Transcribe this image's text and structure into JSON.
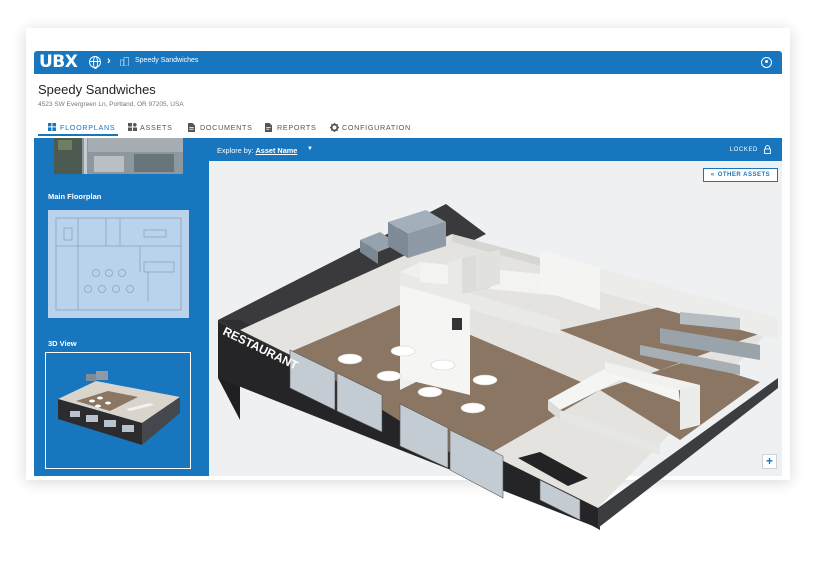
{
  "app": {
    "logo": "UBX"
  },
  "breadcrumb": {
    "location": "Speedy Sandwiches"
  },
  "site": {
    "title": "Speedy Sandwiches",
    "address": "4523 SW Evergreen Ln, Portland, OR 97205, USA"
  },
  "tabs": [
    {
      "label": "FLOORPLANS",
      "icon": "grid-icon",
      "active": true
    },
    {
      "label": "ASSETS",
      "icon": "assets-icon",
      "active": false
    },
    {
      "label": "DOCUMENTS",
      "icon": "document-icon",
      "active": false
    },
    {
      "label": "REPORTS",
      "icon": "report-icon",
      "active": false
    },
    {
      "label": "CONFIGURATION",
      "icon": "gear-icon",
      "active": false
    }
  ],
  "sidebar": {
    "main_floorplan_label": "Main Floorplan",
    "view3d_label": "3D View"
  },
  "explore": {
    "prefix": "Explore by: ",
    "value": "Asset Name"
  },
  "lock_status": "LOCKED",
  "other_assets_label": "OTHER ASSETS",
  "zoom_in_label": "+",
  "model": {
    "sign_text": "RESTAURANT"
  },
  "colors": {
    "brand_blue": "#1876bf",
    "floor_brown": "#8b7563",
    "wall_dark": "#2c2c2e"
  }
}
